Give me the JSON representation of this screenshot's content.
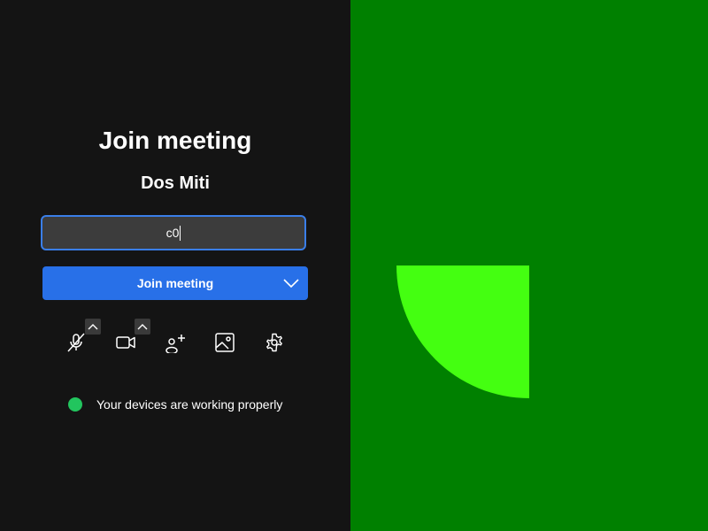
{
  "join": {
    "title": "Join meeting",
    "user_name": "Dos Miti",
    "name_input_value": "c0",
    "join_button_label": "Join meeting"
  },
  "controls": {
    "microphone_icon": "mic-off-icon",
    "camera_icon": "video-icon",
    "invite_icon": "add-person-icon",
    "background_icon": "image-icon",
    "settings_icon": "gear-icon"
  },
  "status": {
    "text": "Your devices are working properly",
    "color": "#22c55e"
  },
  "colors": {
    "accent": "#2870e8",
    "video_background": "#008000",
    "video_shape": "#44ff11"
  }
}
